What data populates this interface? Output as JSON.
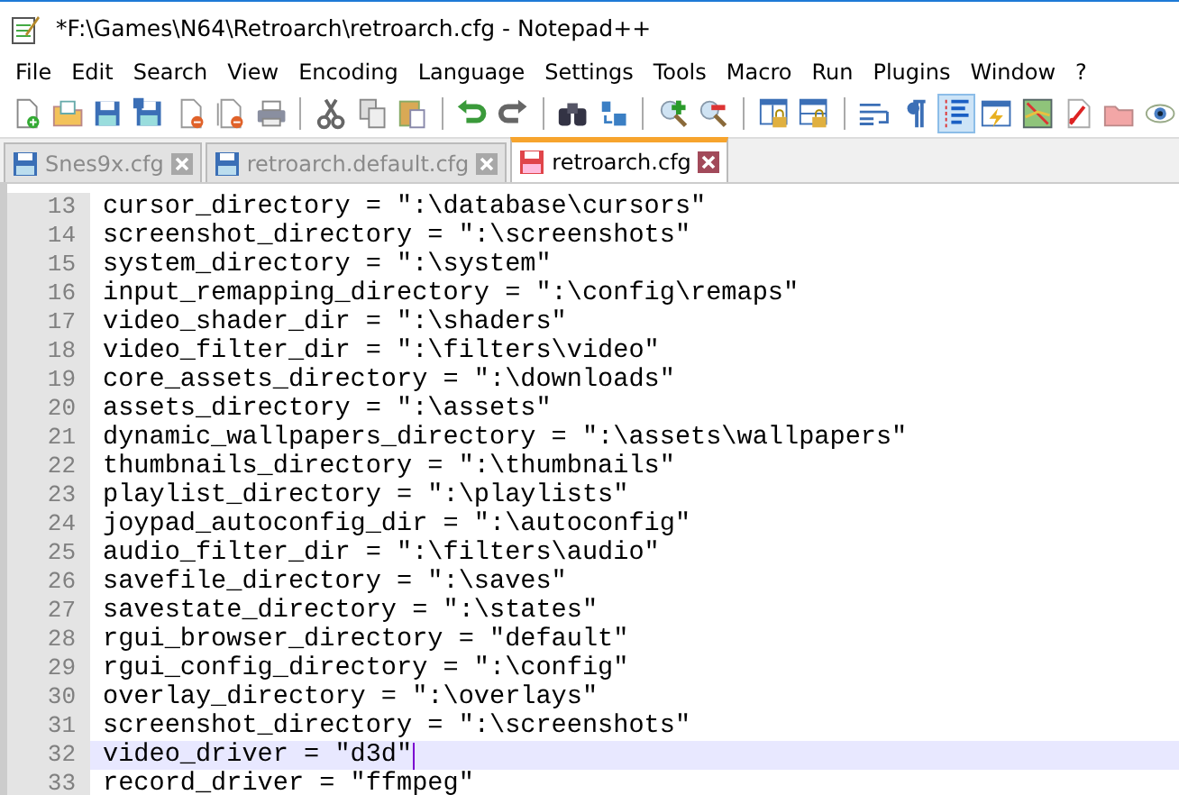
{
  "window": {
    "title": "*F:\\Games\\N64\\Retroarch\\retroarch.cfg - Notepad++"
  },
  "menu": [
    "File",
    "Edit",
    "Search",
    "View",
    "Encoding",
    "Language",
    "Settings",
    "Tools",
    "Macro",
    "Run",
    "Plugins",
    "Window",
    "?"
  ],
  "toolbar_groups": [
    {
      "buttons": [
        {
          "kind": "new",
          "selected": false
        },
        {
          "kind": "open",
          "selected": false
        },
        {
          "kind": "save",
          "selected": false
        },
        {
          "kind": "saveall",
          "selected": false
        },
        {
          "kind": "close",
          "selected": false
        },
        {
          "kind": "closeall",
          "selected": false
        },
        {
          "kind": "print",
          "selected": false
        }
      ]
    },
    {
      "buttons": [
        {
          "kind": "cut",
          "selected": false
        },
        {
          "kind": "copy",
          "selected": false
        },
        {
          "kind": "paste",
          "selected": false
        }
      ]
    },
    {
      "buttons": [
        {
          "kind": "undo",
          "selected": false
        },
        {
          "kind": "redo",
          "selected": false
        }
      ]
    },
    {
      "buttons": [
        {
          "kind": "find",
          "selected": false
        },
        {
          "kind": "replace",
          "selected": false
        }
      ]
    },
    {
      "buttons": [
        {
          "kind": "zoomin",
          "selected": false
        },
        {
          "kind": "zoomout",
          "selected": false
        }
      ]
    },
    {
      "buttons": [
        {
          "kind": "syncv",
          "selected": false
        },
        {
          "kind": "synch",
          "selected": false
        }
      ]
    },
    {
      "buttons": [
        {
          "kind": "wrap",
          "selected": false
        },
        {
          "kind": "allchars",
          "selected": false
        },
        {
          "kind": "indent",
          "selected": true
        },
        {
          "kind": "udl",
          "selected": false
        },
        {
          "kind": "docmap",
          "selected": false
        },
        {
          "kind": "funclist",
          "selected": false
        },
        {
          "kind": "folder",
          "selected": false
        },
        {
          "kind": "monitor",
          "selected": false
        }
      ]
    }
  ],
  "tabs": [
    {
      "label": "Snes9x.cfg",
      "selected": false,
      "modified": false
    },
    {
      "label": "retroarch.default.cfg",
      "selected": false,
      "modified": false
    },
    {
      "label": "retroarch.cfg",
      "selected": true,
      "modified": true
    }
  ],
  "lines": [
    {
      "number": "13",
      "text": "cursor_directory = \":\\database\\cursors\"",
      "current": false
    },
    {
      "number": "14",
      "text": "screenshot_directory = \":\\screenshots\"",
      "current": false
    },
    {
      "number": "15",
      "text": "system_directory = \":\\system\"",
      "current": false
    },
    {
      "number": "16",
      "text": "input_remapping_directory = \":\\config\\remaps\"",
      "current": false
    },
    {
      "number": "17",
      "text": "video_shader_dir = \":\\shaders\"",
      "current": false
    },
    {
      "number": "18",
      "text": "video_filter_dir = \":\\filters\\video\"",
      "current": false
    },
    {
      "number": "19",
      "text": "core_assets_directory = \":\\downloads\"",
      "current": false
    },
    {
      "number": "20",
      "text": "assets_directory = \":\\assets\"",
      "current": false
    },
    {
      "number": "21",
      "text": "dynamic_wallpapers_directory = \":\\assets\\wallpapers\"",
      "current": false
    },
    {
      "number": "22",
      "text": "thumbnails_directory = \":\\thumbnails\"",
      "current": false
    },
    {
      "number": "23",
      "text": "playlist_directory = \":\\playlists\"",
      "current": false
    },
    {
      "number": "24",
      "text": "joypad_autoconfig_dir = \":\\autoconfig\"",
      "current": false
    },
    {
      "number": "25",
      "text": "audio_filter_dir = \":\\filters\\audio\"",
      "current": false
    },
    {
      "number": "26",
      "text": "savefile_directory = \":\\saves\"",
      "current": false
    },
    {
      "number": "27",
      "text": "savestate_directory = \":\\states\"",
      "current": false
    },
    {
      "number": "28",
      "text": "rgui_browser_directory = \"default\"",
      "current": false
    },
    {
      "number": "29",
      "text": "rgui_config_directory = \":\\config\"",
      "current": false
    },
    {
      "number": "30",
      "text": "overlay_directory = \":\\overlays\"",
      "current": false
    },
    {
      "number": "31",
      "text": "screenshot_directory = \":\\screenshots\"",
      "current": false
    },
    {
      "number": "32",
      "text": "video_driver = \"d3d\"",
      "current": true
    },
    {
      "number": "33",
      "text": "record_driver = \"ffmpeg\"",
      "current": false
    }
  ]
}
